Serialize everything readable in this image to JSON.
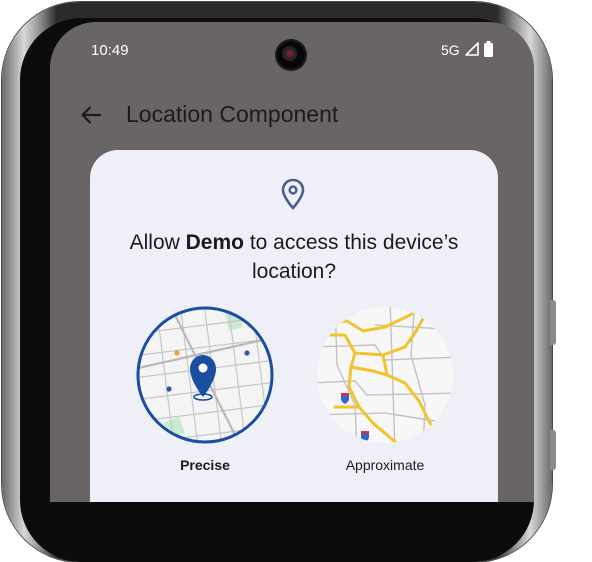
{
  "status_bar": {
    "time": "10:49",
    "network": "5G"
  },
  "app_bar": {
    "title": "Location Component"
  },
  "dialog": {
    "title_prefix": "Allow ",
    "title_app": "Demo",
    "title_suffix": " to access this device’s location?",
    "options": [
      {
        "label": "Precise",
        "selected": true
      },
      {
        "label": "Approximate",
        "selected": false
      }
    ]
  },
  "colors": {
    "screen_bg": "#696567",
    "dialog_bg": "#eff0f7",
    "accent": "#1a4ea1",
    "map_road_yellow": "#f3c22f"
  }
}
